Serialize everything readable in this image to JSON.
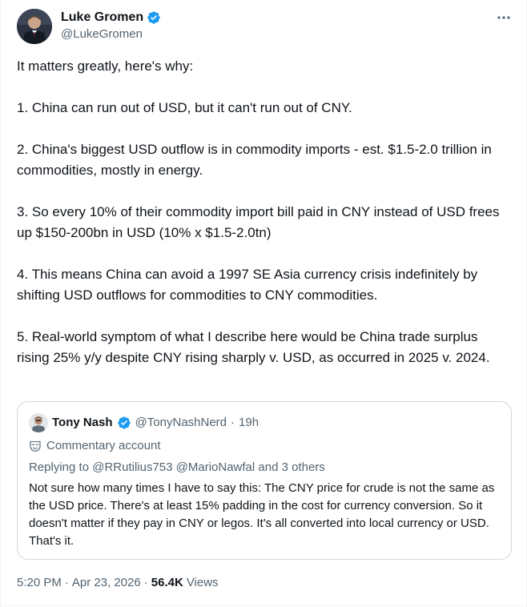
{
  "author": {
    "display_name": "Luke Gromen",
    "handle": "@LukeGromen"
  },
  "tweet": {
    "paragraphs": [
      "It matters greatly, here's why:",
      "1. China can run out of USD, but it can't run out of CNY.",
      "2. China's biggest USD outflow is in commodity imports - est. $1.5-2.0 trillion in commodities, mostly in energy.",
      "3. So every 10% of their commodity import bill paid in CNY instead of USD frees up $150-200bn in USD (10% x $1.5-2.0tn)",
      "4. This means China can avoid a 1997 SE Asia currency crisis indefinitely by shifting USD outflows for commodities to CNY commodities.",
      "5. Real-world symptom of what I describe here would be China trade surplus rising 25% y/y despite CNY rising sharply v. USD, as occurred in 2025 v. 2024."
    ]
  },
  "quote": {
    "display_name": "Tony Nash",
    "handle": "@TonyNashNerd",
    "separator": "·",
    "time": "19h",
    "label": "Commentary account",
    "replying_to": "Replying to @RRutilius753 @MarioNawfal and 3 others",
    "text": "Not sure how many times I have to say this: The CNY price for crude is not the same as the USD price. There's at least 15% padding in the cost for currency conversion. So it doesn't matter if they pay in CNY or legos. It's all converted into local currency or USD. That's it."
  },
  "meta": {
    "time": "5:20 PM",
    "dot": "·",
    "date": "Apr 23, 2026",
    "dot2": "·",
    "views_count": "56.4K",
    "views_label": "Views"
  },
  "icons": {
    "verified_color": "#1d9bf0",
    "more": "more-icon"
  }
}
